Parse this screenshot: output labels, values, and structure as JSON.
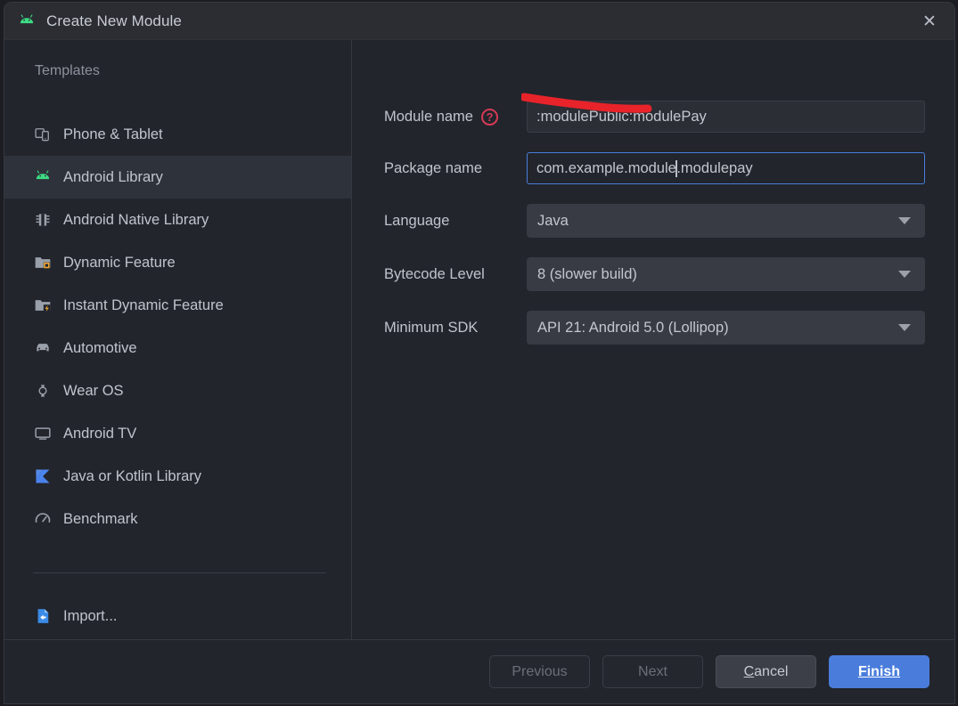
{
  "window": {
    "title": "Create New Module",
    "title_icon": "android-head-icon",
    "close_label": "✕"
  },
  "sidebar": {
    "header": "Templates",
    "items": [
      {
        "label": "Phone & Tablet",
        "icon": "phone-tablet-icon",
        "selected": false
      },
      {
        "label": "Android Library",
        "icon": "android-head-icon",
        "selected": true
      },
      {
        "label": "Android Native Library",
        "icon": "chip-icon",
        "selected": false
      },
      {
        "label": "Dynamic Feature",
        "icon": "folder-square-icon",
        "selected": false
      },
      {
        "label": "Instant Dynamic Feature",
        "icon": "folder-lightning-icon",
        "selected": false
      },
      {
        "label": "Automotive",
        "icon": "car-icon",
        "selected": false
      },
      {
        "label": "Wear OS",
        "icon": "watch-icon",
        "selected": false
      },
      {
        "label": "Android TV",
        "icon": "tv-icon",
        "selected": false
      },
      {
        "label": "Java or Kotlin Library",
        "icon": "kotlin-logo-icon",
        "selected": false
      },
      {
        "label": "Benchmark",
        "icon": "speedometer-icon",
        "selected": false
      }
    ],
    "import": {
      "label": "Import...",
      "icon": "import-file-icon"
    }
  },
  "form": {
    "module_name": {
      "label": "Module name",
      "value": ":modulePublic:modulePay",
      "help_icon": "help-circle-icon",
      "annotated": true
    },
    "package_name": {
      "label": "Package name",
      "value_before_caret": "com.example.module",
      "value_after_caret": ".modulepay",
      "focused": true
    },
    "language": {
      "label": "Language",
      "value": "Java"
    },
    "bytecode_level": {
      "label": "Bytecode Level",
      "value": "8 (slower build)"
    },
    "minimum_sdk": {
      "label": "Minimum SDK",
      "value": "API 21: Android 5.0 (Lollipop)"
    }
  },
  "footer": {
    "previous": {
      "label": "Previous",
      "enabled": false
    },
    "next": {
      "label": "Next",
      "enabled": false
    },
    "cancel": {
      "mnemonic": "C",
      "rest": "ancel",
      "enabled": true
    },
    "finish": {
      "mnemonic": "F",
      "rest": "inish",
      "enabled": true,
      "primary": true
    }
  },
  "colors": {
    "dialog_bg": "#22252c",
    "titlebar_bg": "#2b2d33",
    "selected_row": "#2e323a",
    "accent_blue": "#4a7ddb",
    "android_green": "#3ddc84",
    "annotation_red": "#e8232a",
    "help_red": "#d63a56",
    "orange": "#f0a732",
    "kotlin_blue": "#4d86ef"
  }
}
